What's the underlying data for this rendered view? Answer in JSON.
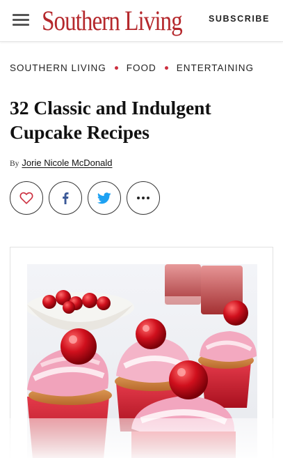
{
  "header": {
    "logo_text": "Southern Living",
    "subscribe_label": "SUBSCRIBE",
    "menu_icon": "hamburger-menu-icon",
    "brand_color": "#b5282c"
  },
  "breadcrumb": {
    "items": [
      "SOUTHERN LIVING",
      "FOOD",
      "ENTERTAINING"
    ],
    "separator_color": "#cc2f3f"
  },
  "article": {
    "title": "32 Classic and Indulgent Cupcake Recipes",
    "by_label": "By",
    "author": "Jorie Nicole McDonald"
  },
  "share": {
    "buttons": [
      {
        "name": "favorite",
        "icon": "heart-icon",
        "color": "#cc2f3f"
      },
      {
        "name": "facebook",
        "icon": "facebook-icon",
        "color": "#3b5998"
      },
      {
        "name": "twitter",
        "icon": "twitter-icon",
        "color": "#1da1f2"
      },
      {
        "name": "more",
        "icon": "more-icon",
        "color": "#222222"
      }
    ]
  },
  "hero_image": {
    "subject": "cupcakes with pink frosting and cherries"
  }
}
